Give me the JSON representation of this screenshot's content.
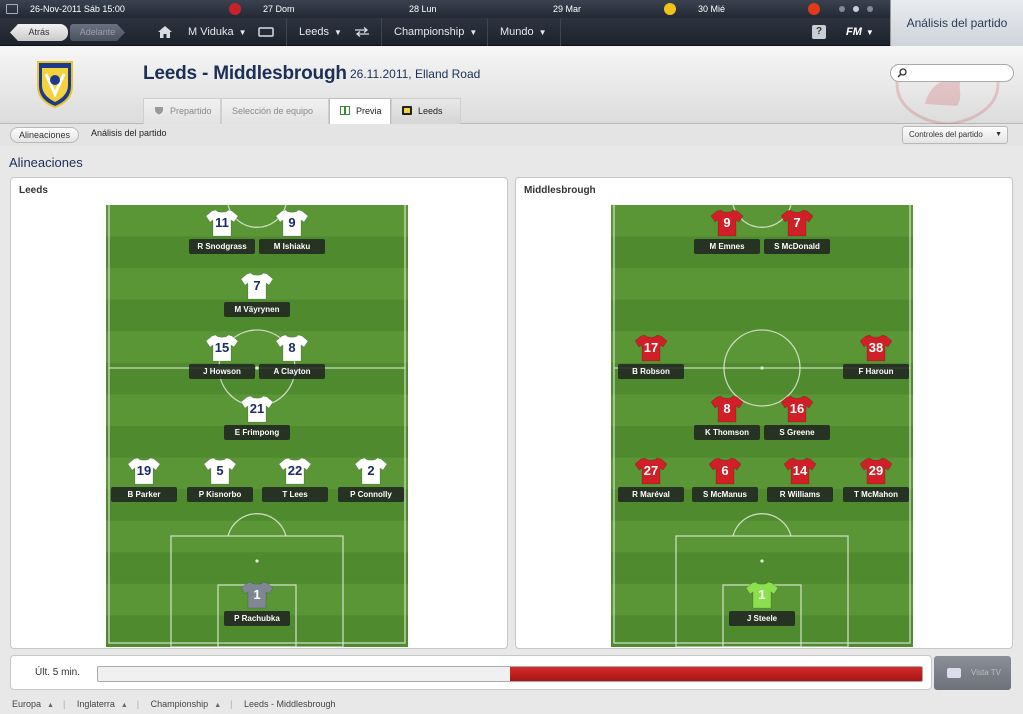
{
  "topbar": {
    "date": "26-Nov-2011 Sáb 15:00",
    "days": [
      "27 Dom",
      "28 Lun",
      "29 Mar",
      "30 Mié"
    ]
  },
  "nav": {
    "back": "Atrás",
    "forward": "Adelante",
    "manager": "M Viduka",
    "club": "Leeds",
    "competition": "Championship",
    "world": "Mundo",
    "help": "?",
    "fm": "FM"
  },
  "right_title": "Análisis del partido",
  "header": {
    "title": "Leeds - Middlesbrough",
    "date_venue": "26.11.2011, Elland Road",
    "tabs": [
      "Prepartido",
      "Selección de equipo",
      "Previa",
      "Leeds"
    ]
  },
  "subbar": {
    "pill": "Alineaciones",
    "crumb": "Análisis del partido",
    "controls": "Controles del partido"
  },
  "section_title": "Alineaciones",
  "home": {
    "team": "Leeds",
    "kit_color": "#ffffff",
    "num_color": "#1c2a66",
    "gk_color": "#7f8793",
    "players": [
      {
        "num": "11",
        "name": "R Snodgrass"
      },
      {
        "num": "9",
        "name": "M Ishiaku"
      },
      {
        "num": "7",
        "name": "M Väyrynen"
      },
      {
        "num": "15",
        "name": "J Howson"
      },
      {
        "num": "8",
        "name": "A Clayton"
      },
      {
        "num": "21",
        "name": "E Frimpong"
      },
      {
        "num": "19",
        "name": "B Parker"
      },
      {
        "num": "5",
        "name": "P Kisnorbo"
      },
      {
        "num": "22",
        "name": "T Lees"
      },
      {
        "num": "2",
        "name": "P Connolly"
      },
      {
        "num": "1",
        "name": "P Rachubka",
        "gk": true
      }
    ]
  },
  "away": {
    "team": "Middlesbrough",
    "kit_color": "#d01f26",
    "num_color": "#ffffff",
    "gk_color": "#8de04d",
    "players": [
      {
        "num": "9",
        "name": "M Emnes"
      },
      {
        "num": "7",
        "name": "S McDonald"
      },
      {
        "num": "17",
        "name": "B Robson"
      },
      {
        "num": "38",
        "name": "F Haroun"
      },
      {
        "num": "8",
        "name": "K Thomson"
      },
      {
        "num": "16",
        "name": "S Greene"
      },
      {
        "num": "27",
        "name": "R Maréval"
      },
      {
        "num": "6",
        "name": "S McManus"
      },
      {
        "num": "14",
        "name": "R Williams"
      },
      {
        "num": "29",
        "name": "T McMahon"
      },
      {
        "num": "1",
        "name": "J Steele",
        "gk": true
      }
    ]
  },
  "momentum": {
    "label": "Últ. 5 min.",
    "away_share": 0.5
  },
  "tv_button": "Vista TV",
  "footer": [
    "Europa",
    "Inglaterra",
    "Championship",
    "Leeds - Middlesbrough"
  ]
}
